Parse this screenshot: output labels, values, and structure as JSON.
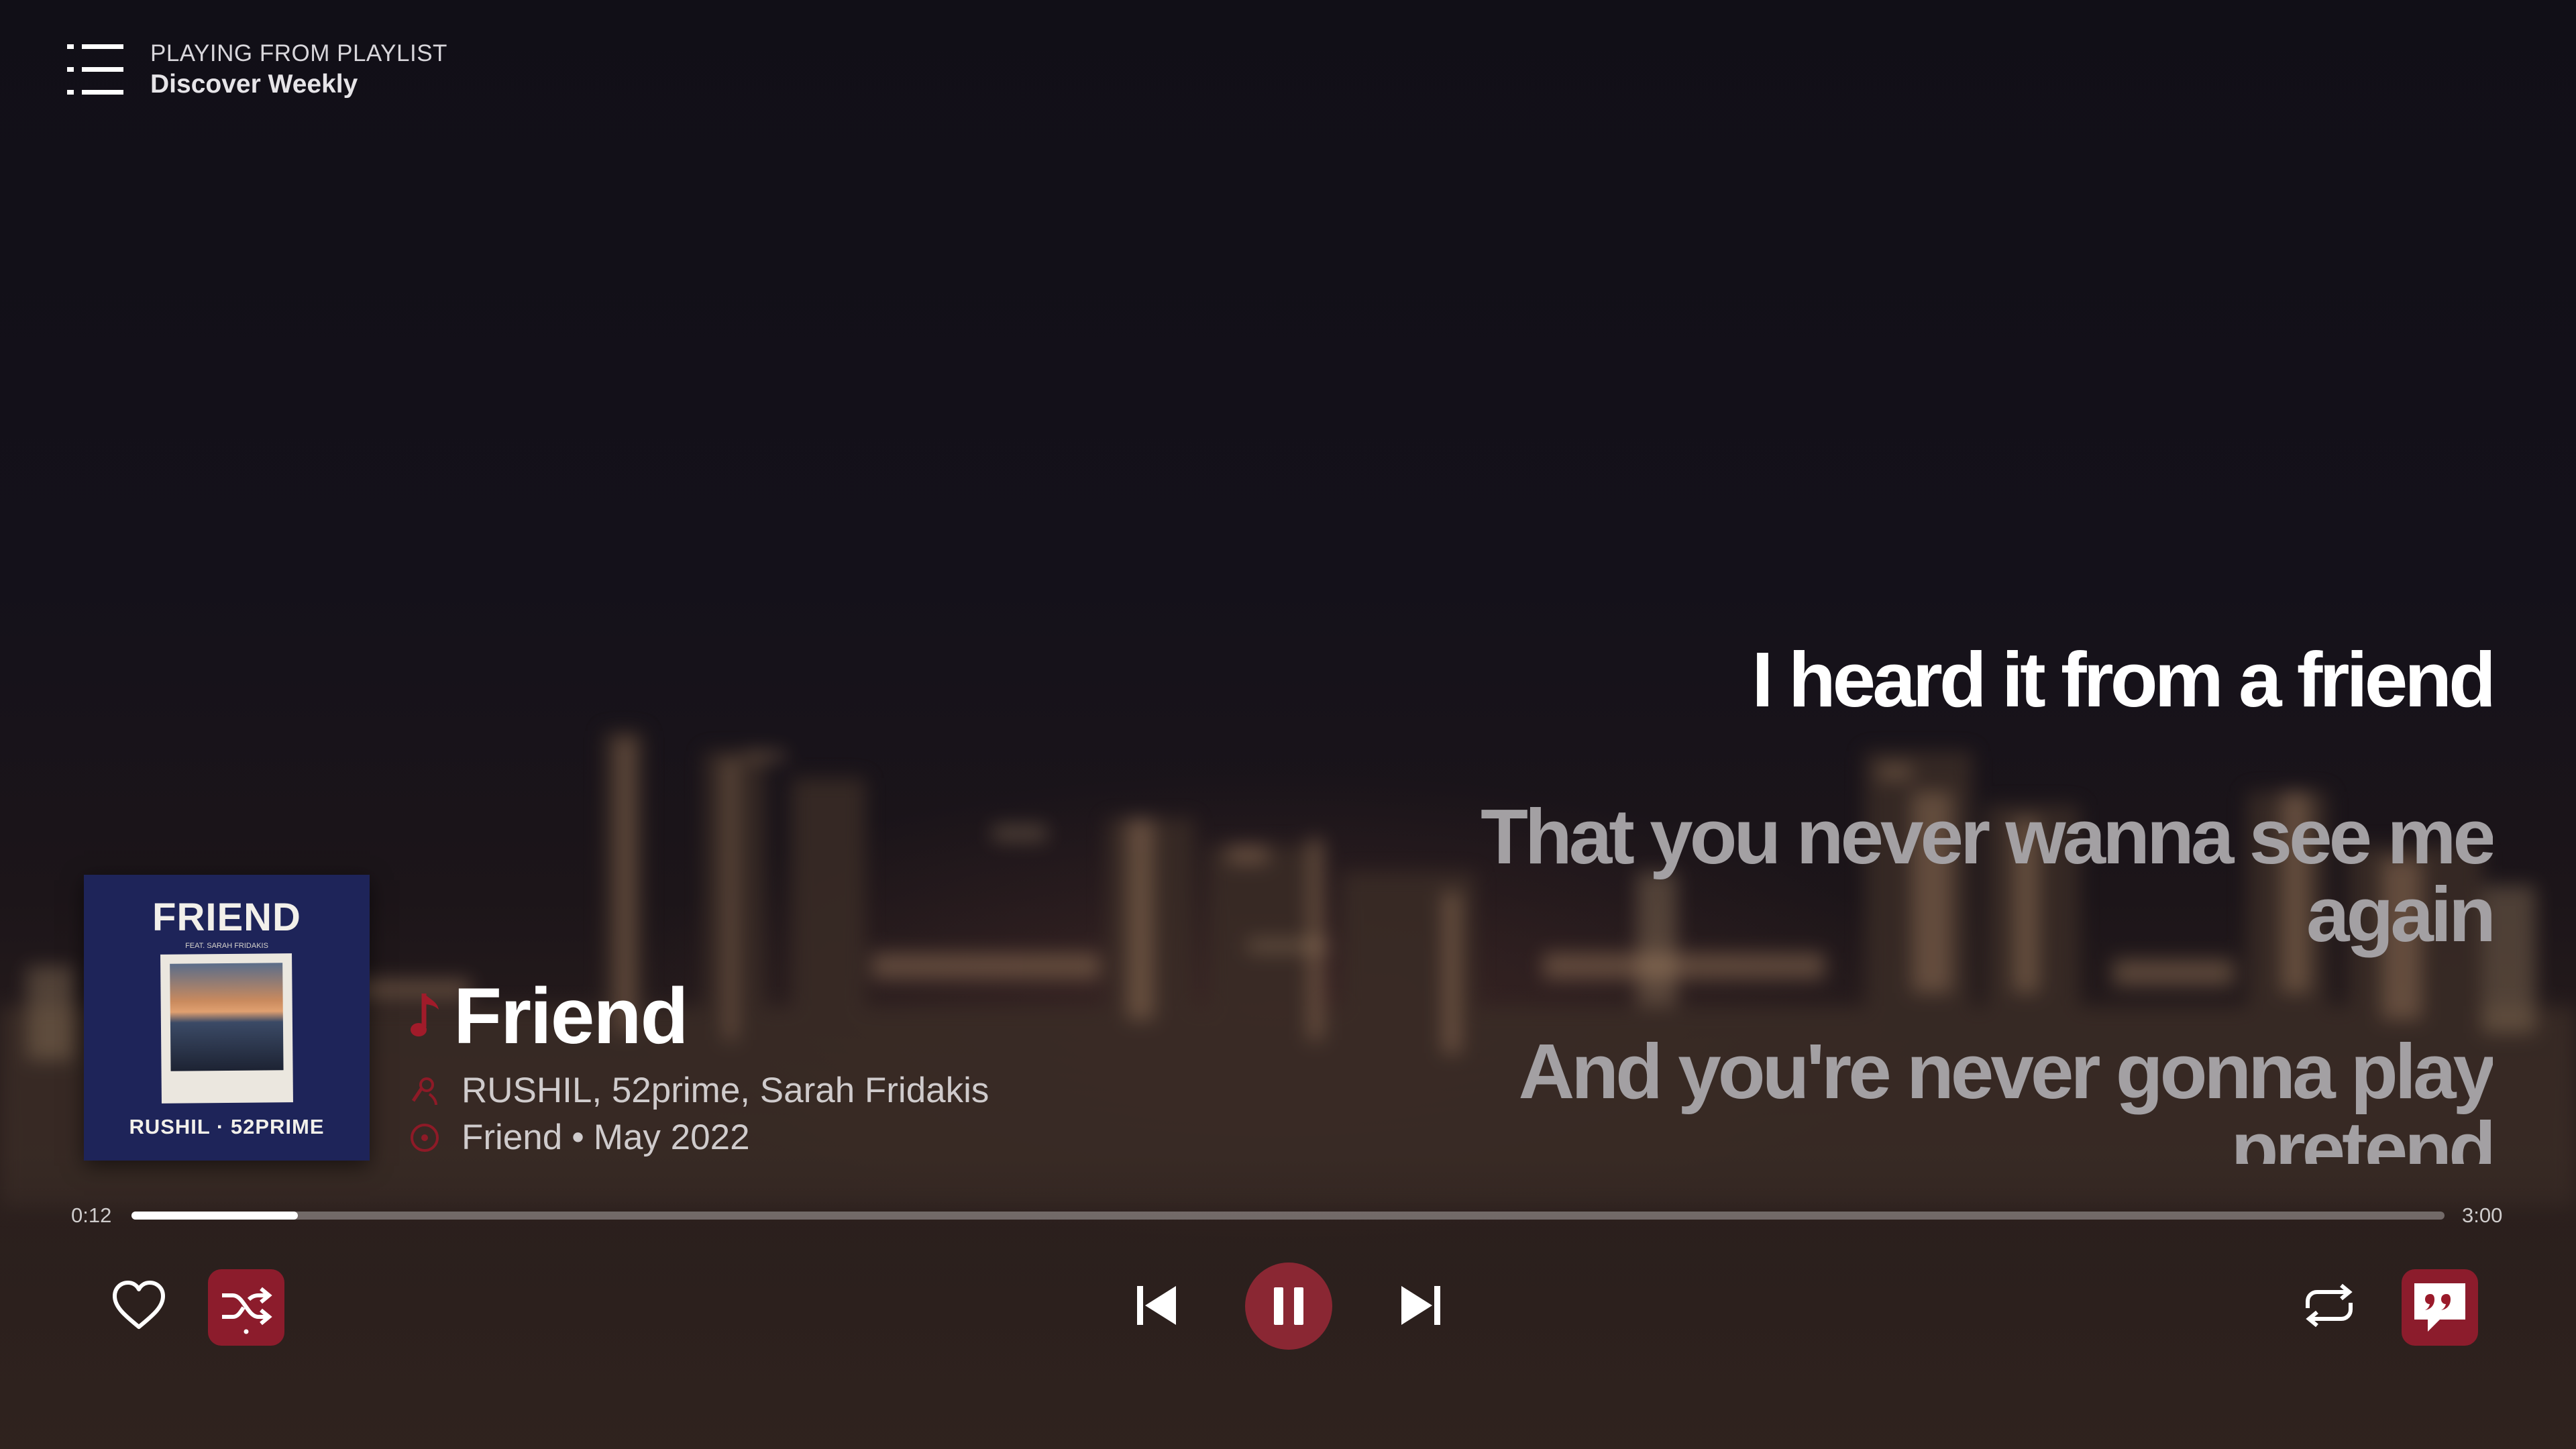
{
  "header": {
    "caption": "PLAYING FROM PLAYLIST",
    "playlist_name": "Discover Weekly",
    "queue_icon": "queue-list-icon"
  },
  "lyrics": {
    "current": "I heard it from a friend",
    "next": [
      "That you never wanna see me again",
      "And you're never gonna play pretend"
    ]
  },
  "track": {
    "title": "Friend",
    "artists": "RUSHIL, 52prime, Sarah Fridakis",
    "album": "Friend",
    "separator": "•",
    "release_date": "May 2022"
  },
  "album_art": {
    "title": "FRIEND",
    "feat": "FEAT. SARAH FRIDAKIS",
    "credit": "RUSHIL · 52PRIME",
    "background_color": "#1e2459"
  },
  "progress": {
    "elapsed": "0:12",
    "total": "3:00",
    "fraction": 0.072
  },
  "controls": {
    "like_icon": "heart-icon",
    "shuffle_icon": "shuffle-icon",
    "shuffle_active": true,
    "previous_icon": "skip-previous-icon",
    "play_state": "playing",
    "pause_icon": "pause-icon",
    "next_icon": "skip-next-icon",
    "repeat_icon": "repeat-icon",
    "lyrics_icon": "lyrics-quote-icon",
    "lyrics_active": true
  },
  "colors": {
    "accent": "#8c1c2c",
    "accent_icon": "#9a1a2a",
    "lyric_active": "#ffffff",
    "lyric_upcoming": "#a3a0a3"
  }
}
